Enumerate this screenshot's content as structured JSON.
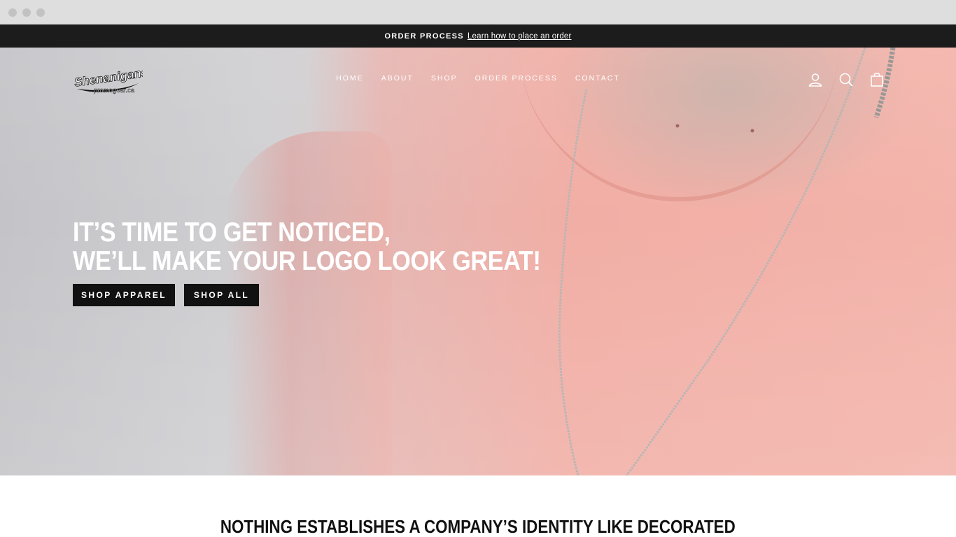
{
  "announcement": {
    "title": "ORDER PROCESS",
    "link": "Learn how to place an order"
  },
  "header": {
    "logo": {
      "brand": "Shenanigans",
      "domain": "promogear.ca"
    },
    "nav": [
      "HOME",
      "ABOUT",
      "SHOP",
      "ORDER PROCESS",
      "CONTACT"
    ],
    "icons": [
      "account-icon",
      "search-icon",
      "cart-icon"
    ]
  },
  "hero": {
    "headline_line1": "IT’S TIME TO GET NOTICED,",
    "headline_line2": "WE’LL MAKE YOUR LOGO LOOK GREAT!",
    "buttons": [
      "SHOP APPAREL",
      "SHOP ALL"
    ]
  },
  "section": {
    "title": "NOTHING ESTABLISHES A COMPANY’S IDENTITY LIKE DECORATED"
  },
  "colors": {
    "announcement_bg": "#1c1c1c",
    "button_bg": "#111111",
    "hero_pink": "#f1aea5"
  }
}
